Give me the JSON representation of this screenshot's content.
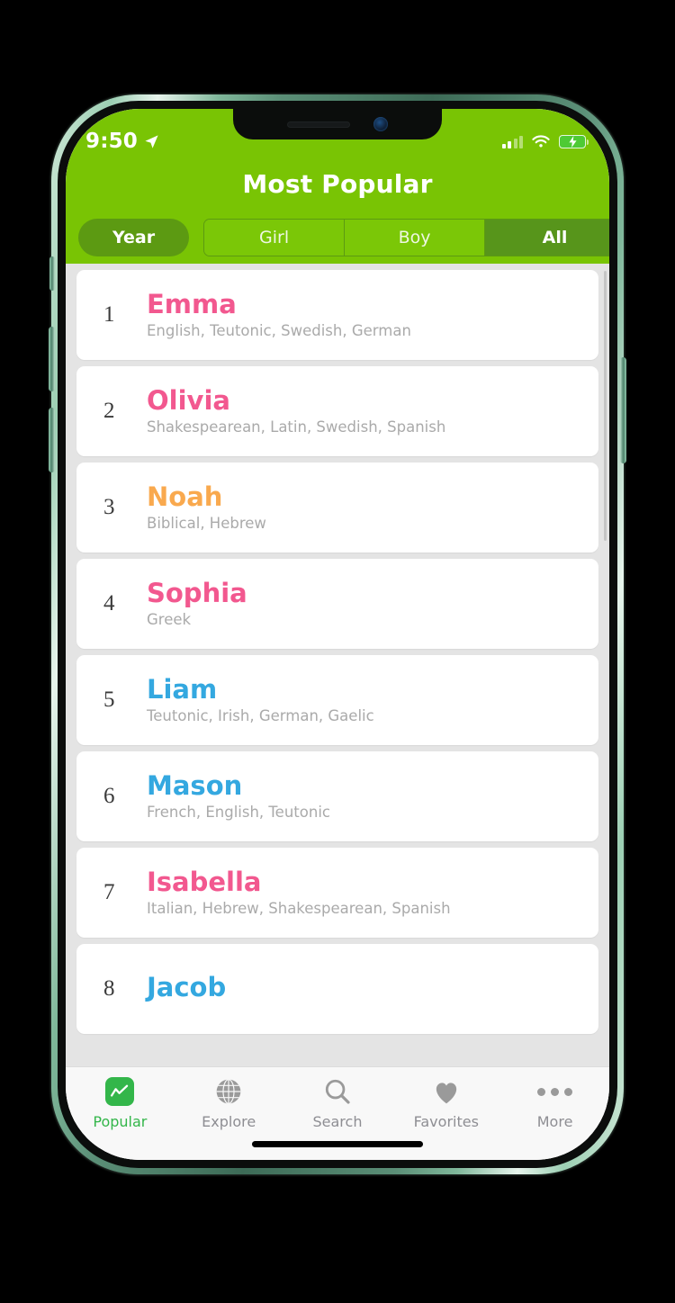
{
  "status_bar": {
    "time": "9:50",
    "location_icon": "location-arrow-icon",
    "signal_icon": "cellular-signal-icon",
    "wifi_icon": "wifi-icon",
    "battery_icon": "battery-charging-icon",
    "signal_bars_filled": 2,
    "signal_bars_total": 4
  },
  "header": {
    "title": "Most Popular",
    "background_color": "#79c404",
    "year_button_label": "Year",
    "year_button_color": "#5c9a12",
    "segments": [
      {
        "label": "Girl",
        "selected": false
      },
      {
        "label": "Boy",
        "selected": false
      },
      {
        "label": "All",
        "selected": true
      }
    ],
    "selected_segment_color": "#57951b"
  },
  "colors": {
    "girl_name": "#f2588f",
    "boy_name": "#34a8e0",
    "neutral_name": "#f9a94e",
    "origins_text": "#aaaaaa",
    "rank_text": "#3b3b3b",
    "list_background": "#e4e4e4",
    "card_background": "#ffffff",
    "tab_active": "#33b64a",
    "tab_inactive": "#8e8e93"
  },
  "list": {
    "rows": [
      {
        "rank": "1",
        "name": "Emma",
        "origins": "English, Teutonic, Swedish, German",
        "color": "#f2588f"
      },
      {
        "rank": "2",
        "name": "Olivia",
        "origins": "Shakespearean, Latin, Swedish, Spanish",
        "color": "#f2588f"
      },
      {
        "rank": "3",
        "name": "Noah",
        "origins": "Biblical, Hebrew",
        "color": "#f9a94e"
      },
      {
        "rank": "4",
        "name": "Sophia",
        "origins": "Greek",
        "color": "#f2588f"
      },
      {
        "rank": "5",
        "name": "Liam",
        "origins": "Teutonic, Irish, German, Gaelic",
        "color": "#34a8e0"
      },
      {
        "rank": "6",
        "name": "Mason",
        "origins": "French, English, Teutonic",
        "color": "#34a8e0"
      },
      {
        "rank": "7",
        "name": "Isabella",
        "origins": "Italian, Hebrew, Shakespearean, Spanish",
        "color": "#f2588f"
      },
      {
        "rank": "8",
        "name": "Jacob",
        "origins": "",
        "color": "#34a8e0"
      }
    ]
  },
  "tab_bar": {
    "tabs": [
      {
        "label": "Popular",
        "icon": "line-chart-icon",
        "active": true
      },
      {
        "label": "Explore",
        "icon": "globe-icon",
        "active": false
      },
      {
        "label": "Search",
        "icon": "search-icon",
        "active": false
      },
      {
        "label": "Favorites",
        "icon": "heart-icon",
        "active": false
      },
      {
        "label": "More",
        "icon": "ellipsis-icon",
        "active": false
      }
    ]
  }
}
